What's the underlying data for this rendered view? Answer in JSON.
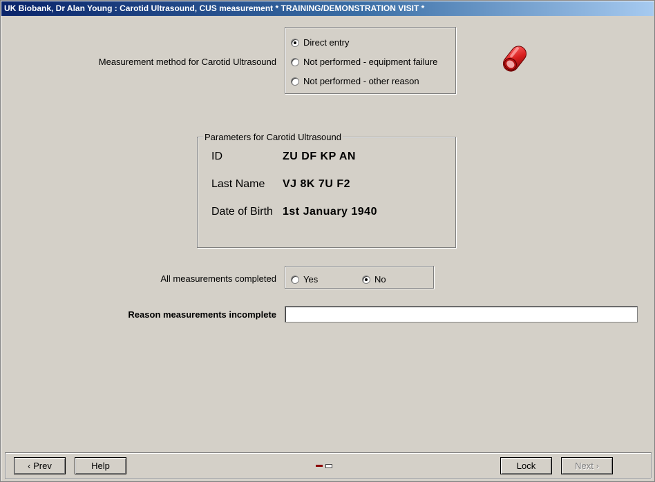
{
  "window": {
    "title": "UK Biobank, Dr Alan Young : Carotid Ultrasound, CUS measurement * TRAINING/DEMONSTRATION VISIT *"
  },
  "method": {
    "label": "Measurement method for Carotid Ultrasound",
    "options": [
      {
        "label": "Direct entry",
        "selected": true
      },
      {
        "label": "Not performed - equipment failure",
        "selected": false
      },
      {
        "label": "Not performed - other reason",
        "selected": false
      }
    ]
  },
  "device_icon": "probe-icon",
  "parameters": {
    "legend": "Parameters  for Carotid Ultrasound",
    "rows": [
      {
        "label": "ID",
        "value": "ZU DF KP AN"
      },
      {
        "label": "Last Name",
        "value": "VJ 8K 7U F2"
      },
      {
        "label": "Date of Birth",
        "value": "1st January 1940"
      }
    ]
  },
  "completed": {
    "label": "All measurements completed",
    "options": [
      {
        "label": "Yes",
        "selected": false
      },
      {
        "label": "No",
        "selected": true
      }
    ]
  },
  "reason": {
    "label": "Reason measurements incomplete",
    "value": ""
  },
  "footer": {
    "prev_label": "Prev",
    "help_label": "Help",
    "lock_label": "Lock",
    "next_label": "Next",
    "prev_icon": "chevron-left-icon",
    "next_icon": "chevron-right-icon"
  },
  "colors": {
    "title_start": "#0a246a",
    "title_end": "#a6caf0",
    "face": "#d4d0c8",
    "page_indicator_active": "#8b0000"
  }
}
